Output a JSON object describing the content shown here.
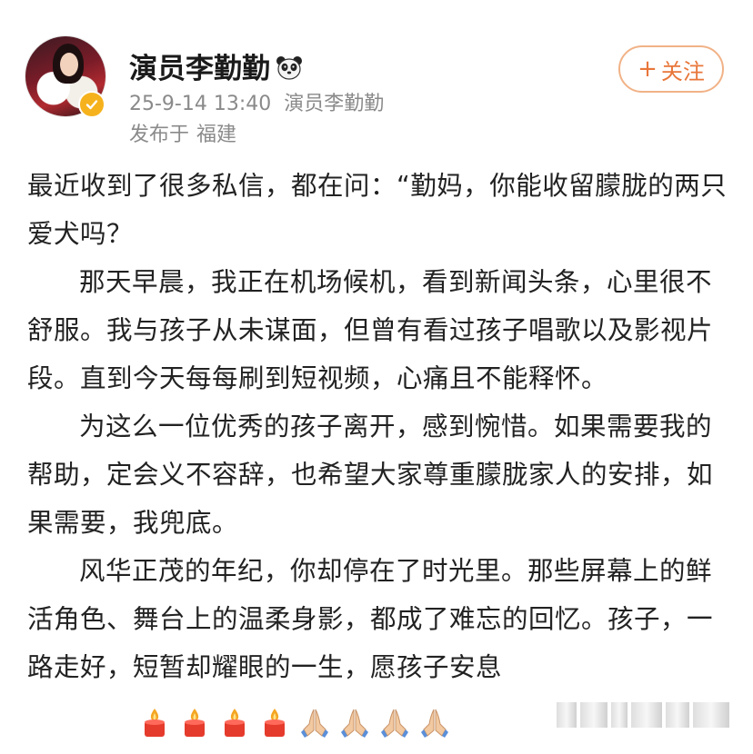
{
  "profile": {
    "name": "演员李勤勤",
    "name_emoji": "panda-icon",
    "verified_color": "#f6b21d",
    "timestamp": "25-9-14 13:40",
    "source": "演员李勤勤",
    "location_prefix": "发布于",
    "location": "福建",
    "follow_label": "关注",
    "follow_symbol": "+"
  },
  "post": {
    "paragraphs": [
      "最近收到了很多私信，都在问：“勤妈，你能收留朦胧的两只爱犬吗？",
      "那天早晨，我正在机场候机，看到新闻头条，心里很不舒服。我与孩子从未谋面，但曾有看过孩子唱歌以及影视片段。直到今天每每刷到短视频，心痛且不能释怀。",
      "为这么一位优秀的孩子离开，感到惋惜。如果需要我的帮助，定会义不容辞，也希望大家尊重朦胧家人的安排，如果需要，我兜底。",
      "风华正茂的年纪，你却停在了时光里。那些屏幕上的鲜活角色、舞台上的温柔身影，都成了难忘的回忆。孩子，一路走好，短暂却耀眼的一生，愿孩子安息"
    ],
    "emojis": [
      "candle-icon",
      "candle-icon",
      "candle-icon",
      "candle-icon",
      "praying-hands-icon",
      "praying-hands-icon",
      "praying-hands-icon",
      "praying-hands-icon"
    ]
  },
  "colors": {
    "follow_accent": "#e8763a",
    "meta_gray": "#8a8a8a"
  }
}
